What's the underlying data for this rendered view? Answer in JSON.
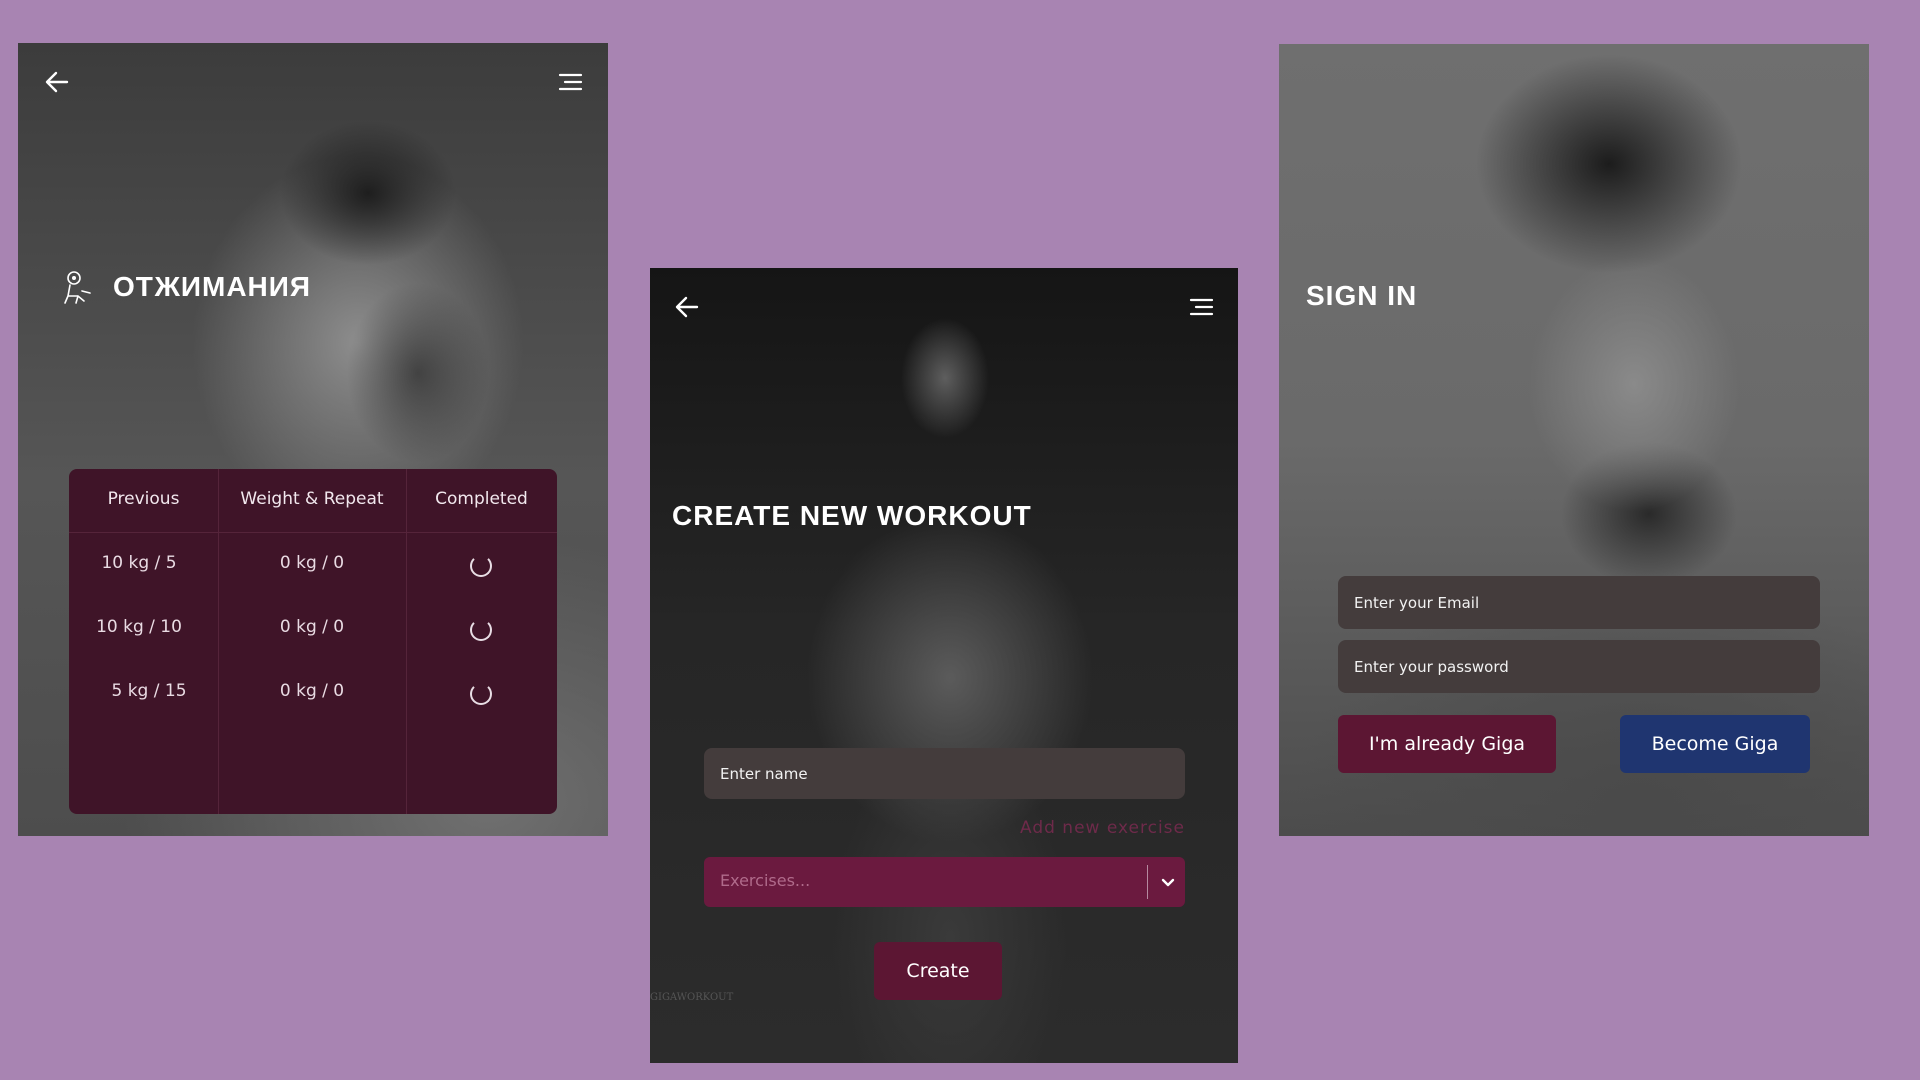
{
  "colors": {
    "background": "#a884b2",
    "table_bg": "#3f1428",
    "input_bg": "#443c3c",
    "primary_button": "#5c1633",
    "secondary_button": "#1f3570",
    "select_bg": "#6b1a3f"
  },
  "exercise_screen": {
    "back_icon": "arrow-left-icon",
    "menu_icon": "menu-icon",
    "exercise_icon": "exercise-icon",
    "title": "ОТЖИМАНИЯ",
    "table": {
      "headers": [
        "Previous",
        "Weight & Repeat",
        "Completed"
      ],
      "rows": [
        {
          "previous": "10 kg / 5",
          "weight_repeat": "0 kg / 0",
          "completed_icon": "spinner-icon"
        },
        {
          "previous": "10 kg / 10",
          "weight_repeat": "0 kg / 0",
          "completed_icon": "spinner-icon"
        },
        {
          "previous": "5 kg / 15",
          "weight_repeat": "0 kg / 0",
          "completed_icon": "spinner-icon"
        }
      ]
    }
  },
  "create_screen": {
    "back_icon": "arrow-left-icon",
    "menu_icon": "menu-icon",
    "title": "CREATE NEW WORKOUT",
    "name_placeholder": "Enter name",
    "add_exercise_link": "Add new exercise",
    "exercises_placeholder": "Exercises...",
    "dropdown_icon": "chevron-down-icon",
    "create_button": "Create",
    "watermark": "GIGAWORKOUT"
  },
  "signin_screen": {
    "title": "SIGN IN",
    "email_placeholder": "Enter your Email",
    "password_placeholder": "Enter your password",
    "login_button": "I'm already Giga",
    "register_button": "Become Giga"
  }
}
